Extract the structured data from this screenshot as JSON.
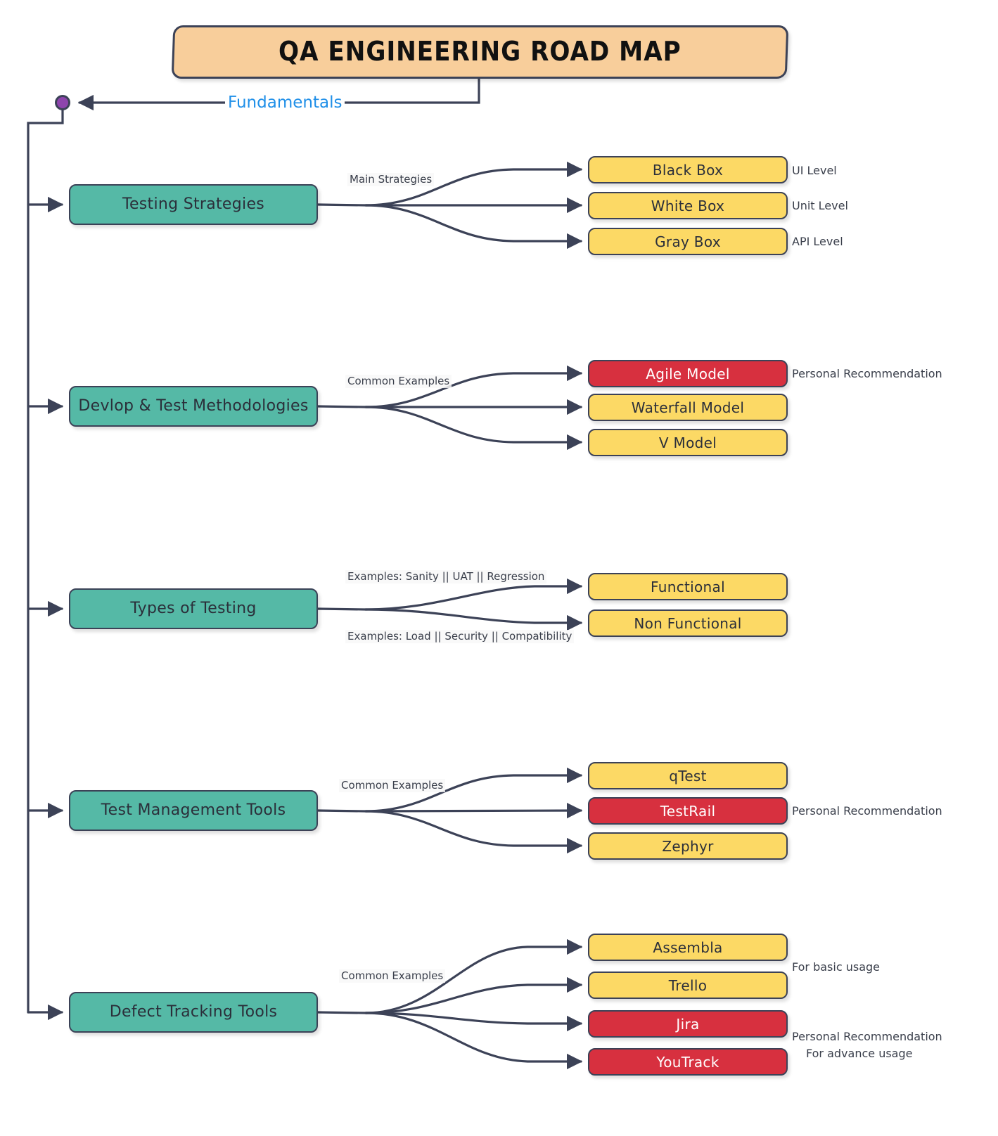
{
  "diagram": {
    "title": "QA ENGINEERING ROAD MAP",
    "root_label": "Fundamentals",
    "root_node_name": "root-dot"
  },
  "colors": {
    "title_fill": "#F8CE9B",
    "category_fill": "#55B9A6",
    "leaf_fill": "#FCD965",
    "recommended_fill": "#D7303F",
    "stroke": "#3c4257",
    "root_dot": "#8E44AD",
    "root_label_text": "#1f8fe8"
  },
  "branches": [
    {
      "id": "testing-strategies",
      "label": "Testing Strategies",
      "edge_labels": [
        "Main Strategies"
      ],
      "children": [
        {
          "label": "Black Box",
          "recommended": false,
          "note": "UI Level"
        },
        {
          "label": "White Box",
          "recommended": false,
          "note": "Unit Level"
        },
        {
          "label": "Gray Box",
          "recommended": false,
          "note": "API Level"
        }
      ]
    },
    {
      "id": "methodologies",
      "label": "Devlop & Test Methodologies",
      "edge_labels": [
        "Common Examples"
      ],
      "children": [
        {
          "label": "Agile Model",
          "recommended": true,
          "note": "Personal Recommendation"
        },
        {
          "label": "Waterfall Model",
          "recommended": false,
          "note": ""
        },
        {
          "label": "V Model",
          "recommended": false,
          "note": ""
        }
      ]
    },
    {
      "id": "types-of-testing",
      "label": "Types of Testing",
      "edge_labels": [
        "Examples: Sanity || UAT || Regression",
        "Examples: Load || Security || Compatibility"
      ],
      "children": [
        {
          "label": "Functional",
          "recommended": false,
          "note": ""
        },
        {
          "label": "Non Functional",
          "recommended": false,
          "note": ""
        }
      ]
    },
    {
      "id": "test-management-tools",
      "label": "Test Management Tools",
      "edge_labels": [
        "Common Examples"
      ],
      "children": [
        {
          "label": "qTest",
          "recommended": false,
          "note": ""
        },
        {
          "label": "TestRail",
          "recommended": true,
          "note": "Personal Recommendation"
        },
        {
          "label": "Zephyr",
          "recommended": false,
          "note": ""
        }
      ]
    },
    {
      "id": "defect-tracking-tools",
      "label": "Defect Tracking Tools",
      "edge_labels": [
        "Common Examples"
      ],
      "children": [
        {
          "label": "Assembla",
          "recommended": false,
          "note": ""
        },
        {
          "label": "Trello",
          "recommended": false,
          "note": "For basic usage"
        },
        {
          "label": "Jira",
          "recommended": true,
          "note": "Personal Recommendation"
        },
        {
          "label": "YouTrack",
          "recommended": true,
          "note": "For advance usage"
        }
      ]
    }
  ],
  "notes": {
    "ui_level": "UI Level",
    "unit_level": "Unit Level",
    "api_level": "API Level",
    "rec_agile": "Personal Recommendation",
    "rec_testrail": "Personal Recommendation",
    "basic_usage": "For basic usage",
    "rec_jira": "Personal Recommendation",
    "advance_usage": "For advance usage"
  }
}
